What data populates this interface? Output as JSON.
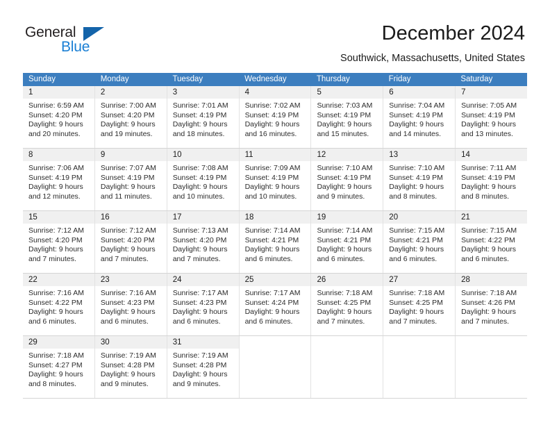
{
  "brand": {
    "name_part1": "General",
    "name_part2": "Blue",
    "triangle_color": "#1464aa",
    "blue_color": "#1a7fd4"
  },
  "header": {
    "title": "December 2024",
    "subtitle": "Southwick, Massachusetts, United States"
  },
  "calendar": {
    "header_bg": "#3c7ebf",
    "daynum_bg": "#f0f0f0",
    "weekdays": [
      "Sunday",
      "Monday",
      "Tuesday",
      "Wednesday",
      "Thursday",
      "Friday",
      "Saturday"
    ],
    "weeks": [
      [
        {
          "day": "1",
          "sunrise": "Sunrise: 6:59 AM",
          "sunset": "Sunset: 4:20 PM",
          "daylight1": "Daylight: 9 hours",
          "daylight2": "and 20 minutes."
        },
        {
          "day": "2",
          "sunrise": "Sunrise: 7:00 AM",
          "sunset": "Sunset: 4:20 PM",
          "daylight1": "Daylight: 9 hours",
          "daylight2": "and 19 minutes."
        },
        {
          "day": "3",
          "sunrise": "Sunrise: 7:01 AM",
          "sunset": "Sunset: 4:19 PM",
          "daylight1": "Daylight: 9 hours",
          "daylight2": "and 18 minutes."
        },
        {
          "day": "4",
          "sunrise": "Sunrise: 7:02 AM",
          "sunset": "Sunset: 4:19 PM",
          "daylight1": "Daylight: 9 hours",
          "daylight2": "and 16 minutes."
        },
        {
          "day": "5",
          "sunrise": "Sunrise: 7:03 AM",
          "sunset": "Sunset: 4:19 PM",
          "daylight1": "Daylight: 9 hours",
          "daylight2": "and 15 minutes."
        },
        {
          "day": "6",
          "sunrise": "Sunrise: 7:04 AM",
          "sunset": "Sunset: 4:19 PM",
          "daylight1": "Daylight: 9 hours",
          "daylight2": "and 14 minutes."
        },
        {
          "day": "7",
          "sunrise": "Sunrise: 7:05 AM",
          "sunset": "Sunset: 4:19 PM",
          "daylight1": "Daylight: 9 hours",
          "daylight2": "and 13 minutes."
        }
      ],
      [
        {
          "day": "8",
          "sunrise": "Sunrise: 7:06 AM",
          "sunset": "Sunset: 4:19 PM",
          "daylight1": "Daylight: 9 hours",
          "daylight2": "and 12 minutes."
        },
        {
          "day": "9",
          "sunrise": "Sunrise: 7:07 AM",
          "sunset": "Sunset: 4:19 PM",
          "daylight1": "Daylight: 9 hours",
          "daylight2": "and 11 minutes."
        },
        {
          "day": "10",
          "sunrise": "Sunrise: 7:08 AM",
          "sunset": "Sunset: 4:19 PM",
          "daylight1": "Daylight: 9 hours",
          "daylight2": "and 10 minutes."
        },
        {
          "day": "11",
          "sunrise": "Sunrise: 7:09 AM",
          "sunset": "Sunset: 4:19 PM",
          "daylight1": "Daylight: 9 hours",
          "daylight2": "and 10 minutes."
        },
        {
          "day": "12",
          "sunrise": "Sunrise: 7:10 AM",
          "sunset": "Sunset: 4:19 PM",
          "daylight1": "Daylight: 9 hours",
          "daylight2": "and 9 minutes."
        },
        {
          "day": "13",
          "sunrise": "Sunrise: 7:10 AM",
          "sunset": "Sunset: 4:19 PM",
          "daylight1": "Daylight: 9 hours",
          "daylight2": "and 8 minutes."
        },
        {
          "day": "14",
          "sunrise": "Sunrise: 7:11 AM",
          "sunset": "Sunset: 4:19 PM",
          "daylight1": "Daylight: 9 hours",
          "daylight2": "and 8 minutes."
        }
      ],
      [
        {
          "day": "15",
          "sunrise": "Sunrise: 7:12 AM",
          "sunset": "Sunset: 4:20 PM",
          "daylight1": "Daylight: 9 hours",
          "daylight2": "and 7 minutes."
        },
        {
          "day": "16",
          "sunrise": "Sunrise: 7:12 AM",
          "sunset": "Sunset: 4:20 PM",
          "daylight1": "Daylight: 9 hours",
          "daylight2": "and 7 minutes."
        },
        {
          "day": "17",
          "sunrise": "Sunrise: 7:13 AM",
          "sunset": "Sunset: 4:20 PM",
          "daylight1": "Daylight: 9 hours",
          "daylight2": "and 7 minutes."
        },
        {
          "day": "18",
          "sunrise": "Sunrise: 7:14 AM",
          "sunset": "Sunset: 4:21 PM",
          "daylight1": "Daylight: 9 hours",
          "daylight2": "and 6 minutes."
        },
        {
          "day": "19",
          "sunrise": "Sunrise: 7:14 AM",
          "sunset": "Sunset: 4:21 PM",
          "daylight1": "Daylight: 9 hours",
          "daylight2": "and 6 minutes."
        },
        {
          "day": "20",
          "sunrise": "Sunrise: 7:15 AM",
          "sunset": "Sunset: 4:21 PM",
          "daylight1": "Daylight: 9 hours",
          "daylight2": "and 6 minutes."
        },
        {
          "day": "21",
          "sunrise": "Sunrise: 7:15 AM",
          "sunset": "Sunset: 4:22 PM",
          "daylight1": "Daylight: 9 hours",
          "daylight2": "and 6 minutes."
        }
      ],
      [
        {
          "day": "22",
          "sunrise": "Sunrise: 7:16 AM",
          "sunset": "Sunset: 4:22 PM",
          "daylight1": "Daylight: 9 hours",
          "daylight2": "and 6 minutes."
        },
        {
          "day": "23",
          "sunrise": "Sunrise: 7:16 AM",
          "sunset": "Sunset: 4:23 PM",
          "daylight1": "Daylight: 9 hours",
          "daylight2": "and 6 minutes."
        },
        {
          "day": "24",
          "sunrise": "Sunrise: 7:17 AM",
          "sunset": "Sunset: 4:23 PM",
          "daylight1": "Daylight: 9 hours",
          "daylight2": "and 6 minutes."
        },
        {
          "day": "25",
          "sunrise": "Sunrise: 7:17 AM",
          "sunset": "Sunset: 4:24 PM",
          "daylight1": "Daylight: 9 hours",
          "daylight2": "and 6 minutes."
        },
        {
          "day": "26",
          "sunrise": "Sunrise: 7:18 AM",
          "sunset": "Sunset: 4:25 PM",
          "daylight1": "Daylight: 9 hours",
          "daylight2": "and 7 minutes."
        },
        {
          "day": "27",
          "sunrise": "Sunrise: 7:18 AM",
          "sunset": "Sunset: 4:25 PM",
          "daylight1": "Daylight: 9 hours",
          "daylight2": "and 7 minutes."
        },
        {
          "day": "28",
          "sunrise": "Sunrise: 7:18 AM",
          "sunset": "Sunset: 4:26 PM",
          "daylight1": "Daylight: 9 hours",
          "daylight2": "and 7 minutes."
        }
      ],
      [
        {
          "day": "29",
          "sunrise": "Sunrise: 7:18 AM",
          "sunset": "Sunset: 4:27 PM",
          "daylight1": "Daylight: 9 hours",
          "daylight2": "and 8 minutes."
        },
        {
          "day": "30",
          "sunrise": "Sunrise: 7:19 AM",
          "sunset": "Sunset: 4:28 PM",
          "daylight1": "Daylight: 9 hours",
          "daylight2": "and 9 minutes."
        },
        {
          "day": "31",
          "sunrise": "Sunrise: 7:19 AM",
          "sunset": "Sunset: 4:28 PM",
          "daylight1": "Daylight: 9 hours",
          "daylight2": "and 9 minutes."
        },
        {
          "day": "",
          "sunrise": "",
          "sunset": "",
          "daylight1": "",
          "daylight2": ""
        },
        {
          "day": "",
          "sunrise": "",
          "sunset": "",
          "daylight1": "",
          "daylight2": ""
        },
        {
          "day": "",
          "sunrise": "",
          "sunset": "",
          "daylight1": "",
          "daylight2": ""
        },
        {
          "day": "",
          "sunrise": "",
          "sunset": "",
          "daylight1": "",
          "daylight2": ""
        }
      ]
    ]
  }
}
